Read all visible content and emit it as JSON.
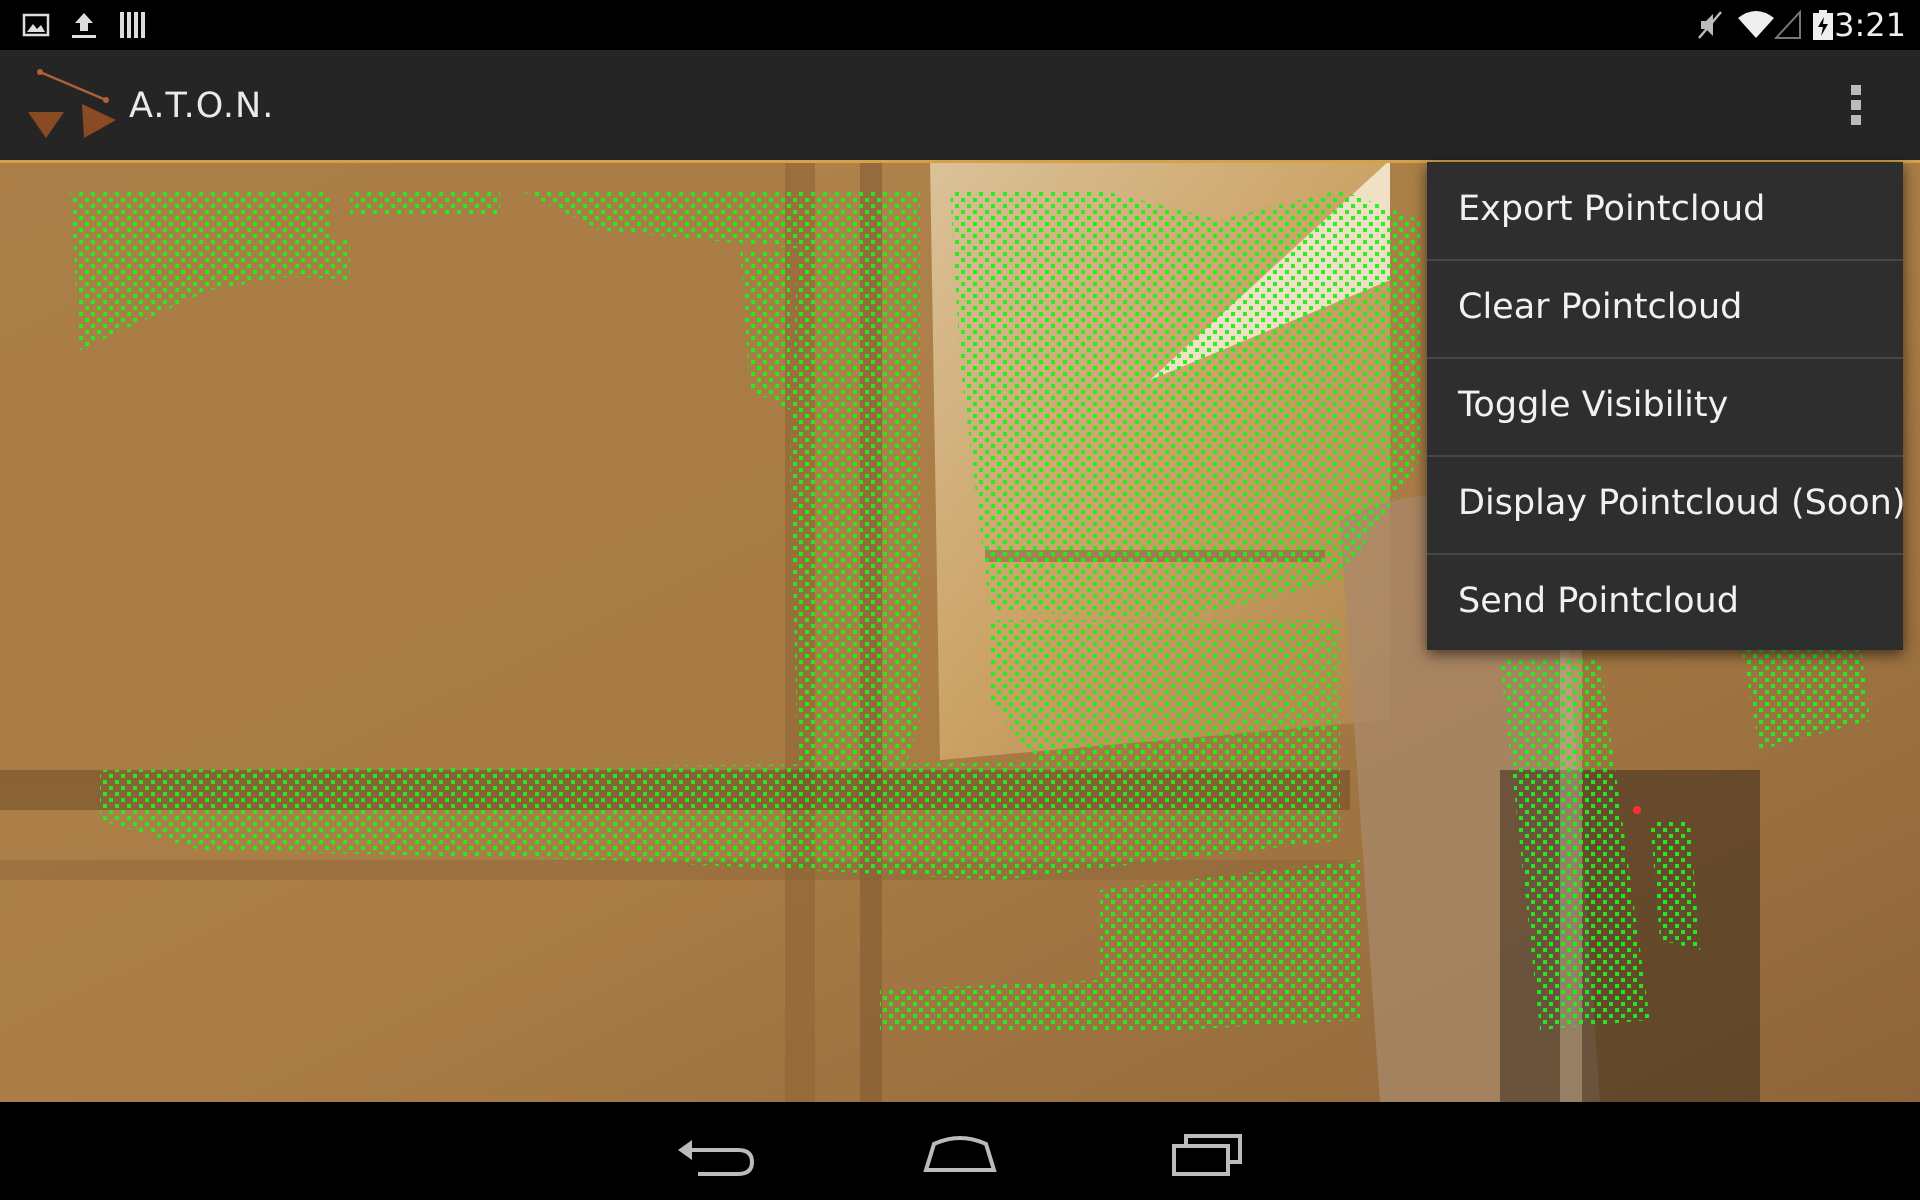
{
  "status_bar": {
    "left_icons": [
      "gallery-icon",
      "upload-icon",
      "storage-icon"
    ],
    "right_icons": [
      "mute-icon",
      "wifi-icon",
      "signal-icon",
      "battery-charging-icon"
    ],
    "time": "3:21"
  },
  "action_bar": {
    "title": "A.T.O.N.",
    "logo_icon": "aton-logo-icon",
    "overflow_icon": "overflow-menu-icon"
  },
  "camera_view": {
    "point_color": "#22ee22",
    "overlay": "pointcloud-features"
  },
  "overflow_menu": {
    "items": [
      {
        "label": "Export Pointcloud"
      },
      {
        "label": "Clear Pointcloud"
      },
      {
        "label": "Toggle Visibility"
      },
      {
        "label": "Display Pointcloud (Soon)"
      },
      {
        "label": "Send Pointcloud"
      }
    ]
  },
  "nav_bar": {
    "buttons": [
      "back-icon",
      "home-icon",
      "recents-icon"
    ]
  },
  "colors": {
    "action_bar": "#252525",
    "menu_bg": "#2e2e2e",
    "accent": "#d4a24a"
  }
}
